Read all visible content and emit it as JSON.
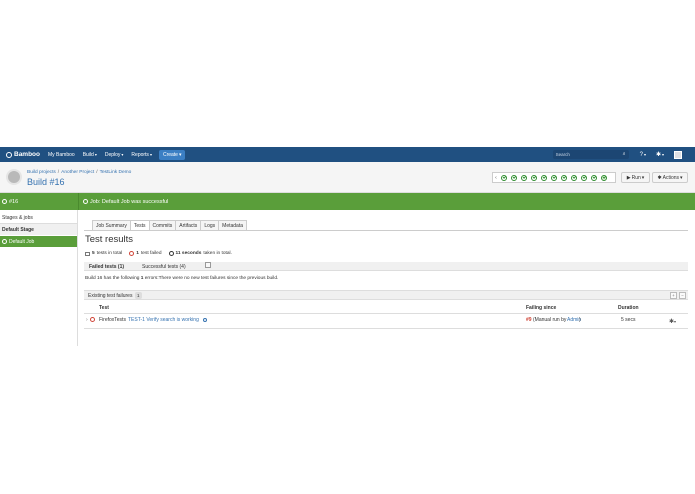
{
  "nav": {
    "brand": "Bamboo",
    "items": [
      "My Bamboo",
      "Build",
      "Deploy",
      "Reports"
    ],
    "create": "Create",
    "search_placeholder": "Search"
  },
  "header": {
    "breadcrumb": [
      "Build projects",
      "Another Project",
      "TestLink Demo"
    ],
    "title": "Build #16",
    "run_label": "Run",
    "actions_label": "Actions",
    "status_history": [
      "success",
      "success",
      "success",
      "success",
      "success",
      "success",
      "success",
      "success",
      "success",
      "success",
      "current"
    ]
  },
  "greenbar": {
    "build_number": "#16",
    "message": "Job: Default Job was successful"
  },
  "sidebar": {
    "stages_jobs": "Stages & jobs",
    "stage": "Default Stage",
    "job": "Default Job"
  },
  "tabs": [
    "Job Summary",
    "Tests",
    "Commits",
    "Artifacts",
    "Logs",
    "Metadata"
  ],
  "active_tab": "Tests",
  "main": {
    "title": "Test results",
    "total_count": "5",
    "total_label": "tests in total",
    "failed_count": "1",
    "failed_label": "test failed",
    "time_value": "11 seconds",
    "time_label": "taken in total.",
    "subtab_failed": "Failed tests (1)",
    "subtab_success": "Successful tests (4)",
    "info_prefix": "Build 16 has the following",
    "info_count": "1",
    "info_suffix": "errors:There were no new test failures since the previous build.",
    "existing_label": "Existing test failures",
    "existing_count": "1"
  },
  "table": {
    "headers": [
      "Test",
      "Failing since",
      "Duration"
    ],
    "rows": [
      {
        "class_name": "FirefoxTests",
        "test_name": "TEST-1 Verify search is working",
        "failing_since_build": "#9",
        "failing_since_text": "(Manual run by",
        "failing_since_user": "Admin",
        "failing_since_end": ")",
        "duration": "5 secs"
      }
    ]
  },
  "colors": {
    "nav_bg": "#205081",
    "success_green": "#5a9e3a",
    "fail_red": "#d04437",
    "link_blue": "#3572b0"
  }
}
